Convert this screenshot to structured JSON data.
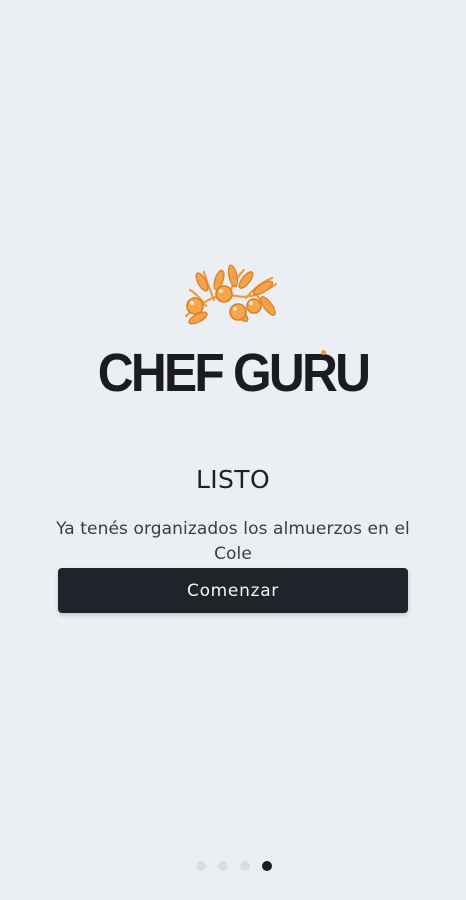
{
  "brand": {
    "name": "CHEF GURU",
    "accent_color": "#F19A3A",
    "logo_icon": "olive-branch-icon"
  },
  "screen": {
    "title": "LISTO",
    "subtitle": "Ya tenés organizados los almuerzos en el Cole"
  },
  "actions": {
    "start_label": "Comenzar"
  },
  "pager": {
    "total": 4,
    "active": 4
  }
}
